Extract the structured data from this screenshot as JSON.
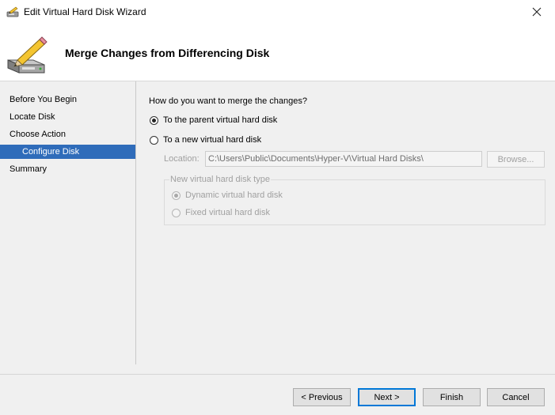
{
  "window": {
    "title": "Edit Virtual Hard Disk Wizard",
    "close_glyph": "✕"
  },
  "header": {
    "title": "Merge Changes from Differencing Disk"
  },
  "sidebar": {
    "items": [
      {
        "label": "Before You Begin"
      },
      {
        "label": "Locate Disk"
      },
      {
        "label": "Choose Action"
      },
      {
        "label": "Configure Disk"
      },
      {
        "label": "Summary"
      }
    ],
    "active": "Configure Disk"
  },
  "main": {
    "question": "How do you want to merge the changes?",
    "option_parent": {
      "label": "To the parent virtual hard disk",
      "checked": true
    },
    "option_new": {
      "label": "To a new virtual hard disk",
      "checked": false
    },
    "location": {
      "label": "Location:",
      "value": "C:\\Users\\Public\\Documents\\Hyper-V\\Virtual Hard Disks\\"
    },
    "browse_label": "Browse...",
    "disk_type": {
      "legend": "New virtual hard disk type",
      "dynamic_label": "Dynamic virtual hard disk",
      "fixed_label": "Fixed virtual hard disk"
    }
  },
  "buttons": {
    "previous": "< Previous",
    "next": "Next >",
    "finish": "Finish",
    "cancel": "Cancel"
  },
  "colors": {
    "selection": "#2f6cba",
    "default_button_border": "#0078d7"
  },
  "icons": {
    "app": "disk-pencil-icon",
    "header": "disk-pencil-icon",
    "close": "close-icon"
  }
}
